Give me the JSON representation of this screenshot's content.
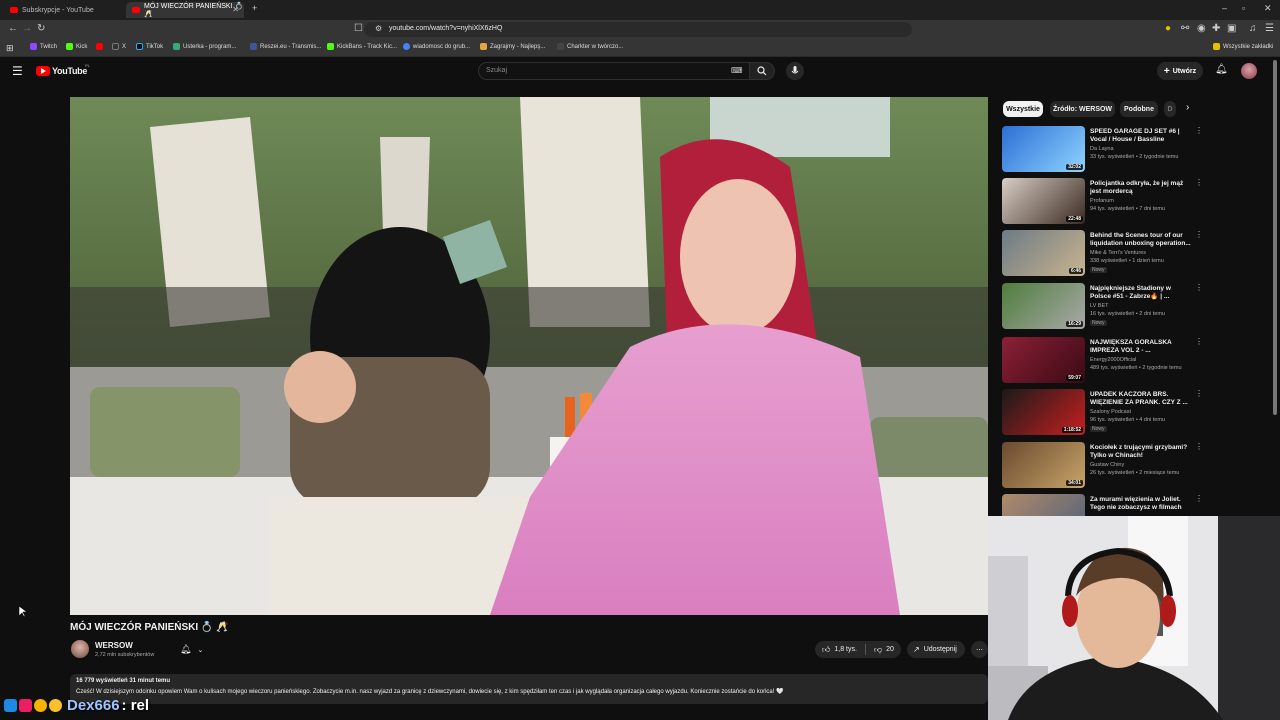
{
  "browser": {
    "tabs": [
      {
        "label": "Subskrypcje - YouTube"
      },
      {
        "label": "MÓJ WIECZÓR PANIEŃSKI 💍 🥂"
      }
    ],
    "url": "youtube.com/watch?v=nyhiXlX6zHQ",
    "bookmarks": [
      "Twitch",
      "Kick",
      "X",
      "TikTok",
      "Usterka - program...",
      "Reszei.eu - Transmis...",
      "KickBans - Track Kic...",
      "wiadomosc do grub...",
      "Zagrajmy - Najlepş...",
      "Charkter w twórczo..."
    ],
    "all_bookmarks": "Wszystkie zakładki"
  },
  "masthead": {
    "logo_text": "YouTube",
    "logo_region": "PL",
    "search_placeholder": "Szukaj",
    "create_label": "Utwórz"
  },
  "video": {
    "title": "MÓJ WIECZÓR PANIEŃSKI 💍 🥂",
    "channel": "WERSOW",
    "subscribers": "2,72 mln subskrybentów",
    "likes": "1,8 tys.",
    "dislikes": "20",
    "share_label": "Udostępnij",
    "views_time": "16 779 wyświetleń  31 minut temu",
    "description": "Cześć! W dzisiejszym odcinku opowiem Wam o kulisach mojego wieczoru panieńskiego. Zobaczycie m.in. nasz wyjazd za granicę z dziewczynami, dowiecie się, z kim spędziłam ten czas i jak wyglądała organizacja całego wyjazdu. Koniecznie zostańcie do końca! 🤍"
  },
  "chips": [
    "Wszystkie",
    "Źródło: WERSOW",
    "Podobne",
    "D"
  ],
  "recommendations": [
    {
      "title": "SPEED GARAGE DJ SET #6 | Vocal / House / Bassline",
      "channel": "Da Layna",
      "meta": "33 tys. wyświetleń • 2 tygodnie temu",
      "duration": "32:02",
      "badge": "",
      "color1": "#2b6fd6",
      "color2": "#8fd3ff"
    },
    {
      "title": "Policjantka odkryła, że jej mąż jest mordercą",
      "channel": "Profanum",
      "meta": "94 tys. wyświetleń • 7 dni temu",
      "duration": "22:48",
      "badge": "",
      "color1": "#d9cfc4",
      "color2": "#3a2a22"
    },
    {
      "title": "Behind the Scenes tour of our liquidation unboxing operation...",
      "channel": "Mike & Terri's Ventures",
      "meta": "338 wyświetleń • 1 dzień temu",
      "duration": "6:46",
      "badge": "Nowy",
      "color1": "#6d7a86",
      "color2": "#c9b48d"
    },
    {
      "title": "Najpiękniejsze Stadiony w Polsce #51 - Zabrze🔥 | ...",
      "channel": "LV BET",
      "meta": "16 tys. wyświetleń • 2 dni temu",
      "duration": "16:29",
      "badge": "Nowy",
      "color1": "#4f7d3d",
      "color2": "#a9a9a9"
    },
    {
      "title": "NAJWIĘKSZA GÓRALSKA IMPREZA VOL 2 - ...",
      "channel": "Energy2000Official",
      "meta": "489 tys. wyświetleń • 2 tygodnie temu",
      "duration": "59:07",
      "badge": "",
      "color1": "#8c2036",
      "color2": "#3a0a14"
    },
    {
      "title": "UPADEK KACZORA BRS. WIĘZIENIE ZA PRANK. CZY Z ...",
      "channel": "Szalony Podcast",
      "meta": "96 tys. wyświetleń • 4 dni temu",
      "duration": "1:18:52",
      "badge": "Nowy",
      "color1": "#1a1a1a",
      "color2": "#c71f1f"
    },
    {
      "title": "Kociołek z trującymi grzybami? Tylko w Chinach!",
      "channel": "Gustaw Chiny",
      "meta": "26 tys. wyświetleń • 2 miesiące temu",
      "duration": "34:01",
      "badge": "",
      "color1": "#6a4a2e",
      "color2": "#c8a46a"
    },
    {
      "title": "Za murami więzienia w Joliet. Tego nie zobaczysz w filmach",
      "channel": "",
      "meta": "",
      "duration": "",
      "badge": "",
      "color1": "#b08a6a",
      "color2": "#50617a"
    }
  ],
  "chat": {
    "username": "Dex666",
    "message": ": rel"
  }
}
